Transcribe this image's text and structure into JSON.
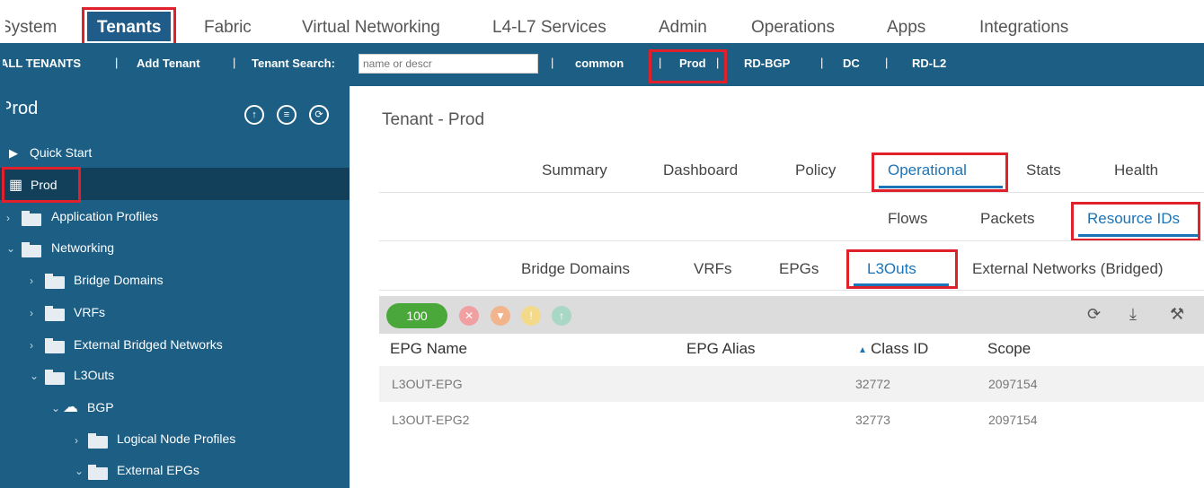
{
  "topnav": {
    "items": [
      "System",
      "Tenants",
      "Fabric",
      "Virtual Networking",
      "L4-L7 Services",
      "Admin",
      "Operations",
      "Apps",
      "Integrations"
    ],
    "active": "Tenants"
  },
  "subnav": {
    "all_tenants": "ALL TENANTS",
    "add_tenant": "Add Tenant",
    "tenant_search_label": "Tenant Search:",
    "search_placeholder": "name or descr",
    "tenants": [
      "common",
      "Prod",
      "RD-BGP",
      "DC",
      "RD-L2"
    ],
    "active_tenant": "Prod",
    "separator": "|"
  },
  "sidebar": {
    "header": "Prod",
    "items": [
      {
        "label": "Quick Start"
      },
      {
        "label": "Prod"
      },
      {
        "label": "Application Profiles"
      },
      {
        "label": "Networking"
      },
      {
        "label": "Bridge Domains"
      },
      {
        "label": "VRFs"
      },
      {
        "label": "External Bridged Networks"
      },
      {
        "label": "L3Outs"
      },
      {
        "label": "BGP"
      },
      {
        "label": "Logical Node Profiles"
      },
      {
        "label": "External EPGs"
      }
    ],
    "selected": "Prod"
  },
  "main": {
    "title": "Tenant - Prod",
    "tabs": [
      "Summary",
      "Dashboard",
      "Policy",
      "Operational",
      "Stats",
      "Health"
    ],
    "active_tab": "Operational",
    "subtabs": [
      "Flows",
      "Packets",
      "Resource IDs"
    ],
    "active_subtab": "Resource IDs",
    "resource_tabs": [
      "Bridge Domains",
      "VRFs",
      "EPGs",
      "L3Outs",
      "External Networks (Bridged)"
    ],
    "active_resource_tab": "L3Outs",
    "health_score": "100",
    "table": {
      "columns": [
        "EPG Name",
        "EPG Alias",
        "Class ID",
        "Scope"
      ],
      "sort_indicator": "▲",
      "rows": [
        {
          "epg_name": "L3OUT-EPG",
          "epg_alias": "",
          "class_id": "32772",
          "scope": "2097154"
        },
        {
          "epg_name": "L3OUT-EPG2",
          "epg_alias": "",
          "class_id": "32773",
          "scope": "2097154"
        }
      ]
    }
  },
  "colors": {
    "nav_blue": "#1c5e84",
    "accent_blue": "#1b74b8",
    "highlight_red": "#e0202a",
    "health_green": "#4aa83a"
  },
  "icons": [
    "refresh-icon",
    "download-icon",
    "tools-icon",
    "cloud-icon",
    "folder-icon",
    "quickstart-icon",
    "tenant-icon"
  ]
}
